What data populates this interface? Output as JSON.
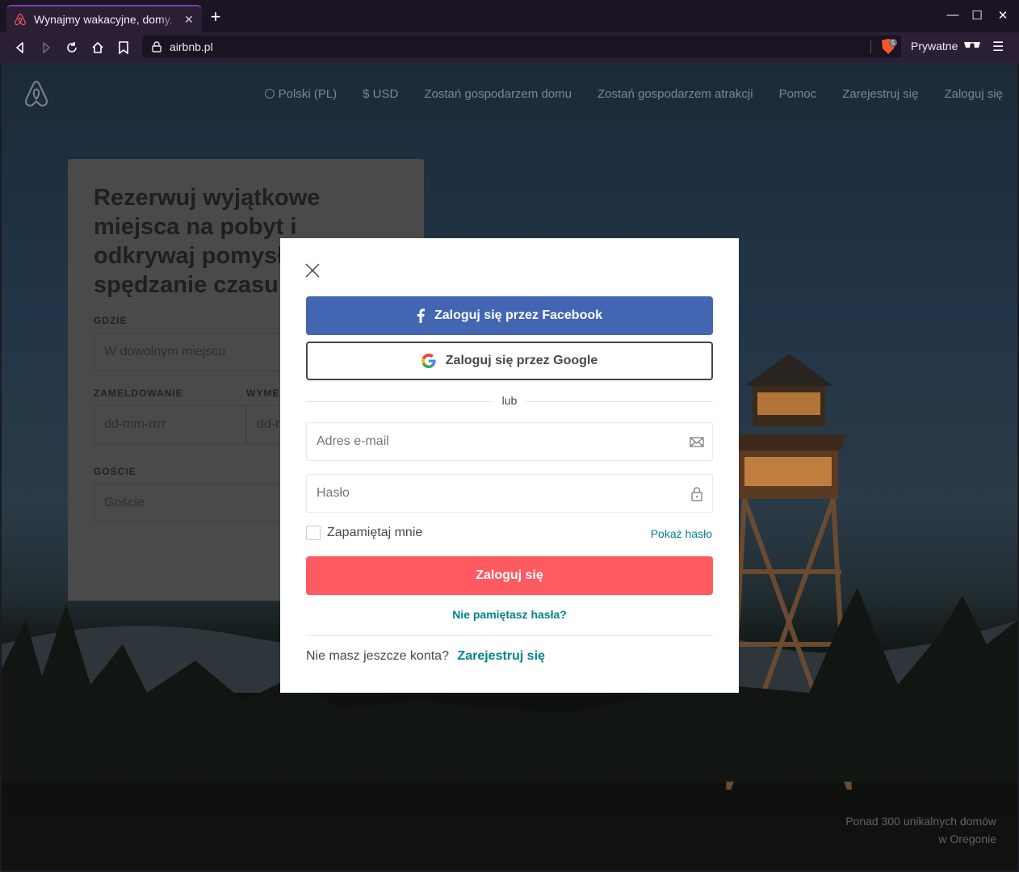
{
  "browser": {
    "tab_title": "Wynajmy wakacyjne, domy, ",
    "tab_close": "✕",
    "new_tab": "+",
    "url": "airbnb.pl",
    "shield_count": "5",
    "private_label": "Prywatne",
    "window_controls": {
      "minimize": "—",
      "maximize": "☐",
      "close": "✕"
    }
  },
  "header": {
    "nav": {
      "language": "Polski (PL)",
      "currency": "$ USD",
      "host_home": "Zostań gospodarzem domu",
      "host_experience": "Zostań gospodarzem atrakcji",
      "help": "Pomoc",
      "signup": "Zarejestruj się",
      "login": "Zaloguj się"
    }
  },
  "search_card": {
    "title": "Rezerwuj wyjątkowe miejsca na pobyt i odkrywaj pomysły na spędzanie czasu",
    "where_label": "GDZIE",
    "where_placeholder": "W dowolnym miejscu",
    "checkin_label": "ZAMELDOWANIE",
    "checkin_placeholder": "dd-mm-rrrr",
    "checkout_label": "WYMELDOWANIE",
    "checkout_placeholder": "dd-mm-rrrr",
    "guests_label": "GOŚCIE",
    "guests_placeholder": "Goście"
  },
  "caption": {
    "line1": "Ponad 300 unikalnych domów",
    "line2": "w Oregonie"
  },
  "modal": {
    "facebook_label": "Zaloguj się przez Facebook",
    "google_label": "Zaloguj się przez Google",
    "or_label": "lub",
    "email_placeholder": "Adres e-mail",
    "password_placeholder": "Hasło",
    "remember_label": "Zapamiętaj mnie",
    "show_password": "Pokaż hasło",
    "login_label": "Zaloguj się",
    "forgot_label": "Nie pamiętasz hasła?",
    "no_account_label": "Nie masz jeszcze konta?",
    "signup_label": "Zarejestruj się"
  },
  "colors": {
    "facebook": "#4266b2",
    "primary": "#ff5a5f",
    "link": "#008489",
    "browser_chrome": "#2b1f36"
  }
}
